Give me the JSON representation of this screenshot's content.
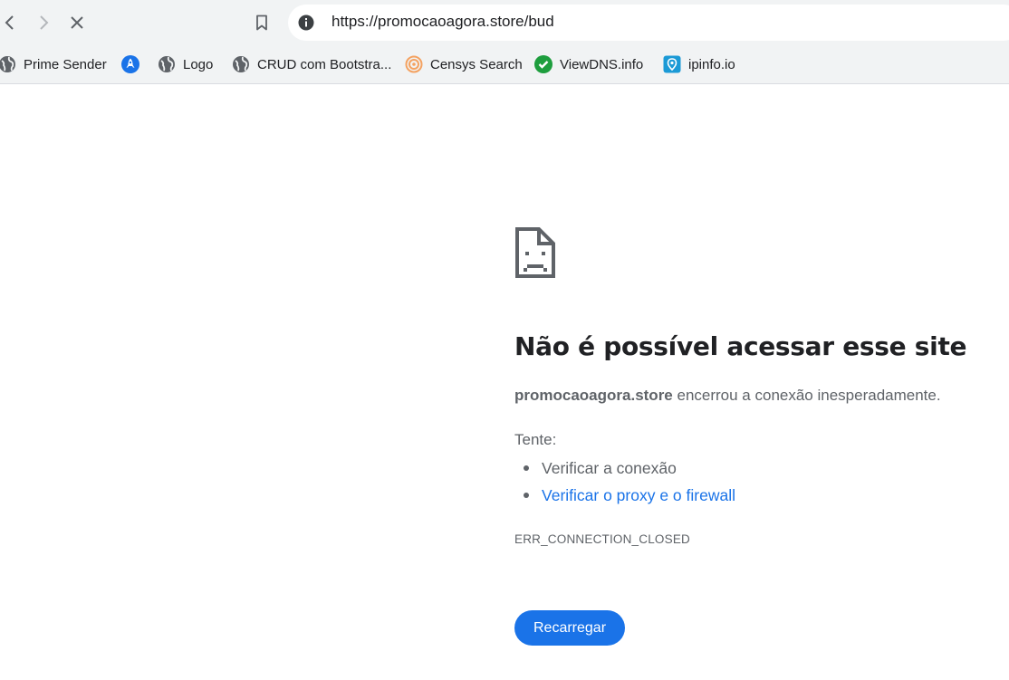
{
  "browser": {
    "url": "https://promocaoagora.store/bud",
    "bookmarks": [
      {
        "label": "Prime Sender",
        "icon": "globe-icon"
      },
      {
        "label": "",
        "icon": "rocket-icon"
      },
      {
        "label": "Logo",
        "icon": "globe-icon"
      },
      {
        "label": "CRUD com Bootstra...",
        "icon": "globe-icon"
      },
      {
        "label": "Censys Search",
        "icon": "censys-icon"
      },
      {
        "label": "ViewDNS.info",
        "icon": "check-circle-icon"
      },
      {
        "label": "ipinfo.io",
        "icon": "ipinfo-icon"
      }
    ]
  },
  "error_page": {
    "title": "Não é possível acessar esse site",
    "host": "promocaoagora.store",
    "message_rest": " encerrou a conexão inesperadamente.",
    "try_label": "Tente:",
    "suggestions": [
      "Verificar a conexão",
      "Verificar o proxy e o firewall"
    ],
    "error_code": "ERR_CONNECTION_CLOSED",
    "reload_label": "Recarregar"
  },
  "colors": {
    "toolbar_bg": "#f1f3f4",
    "accent": "#1a73e8",
    "text_primary": "#202124",
    "text_secondary": "#5f6368"
  }
}
